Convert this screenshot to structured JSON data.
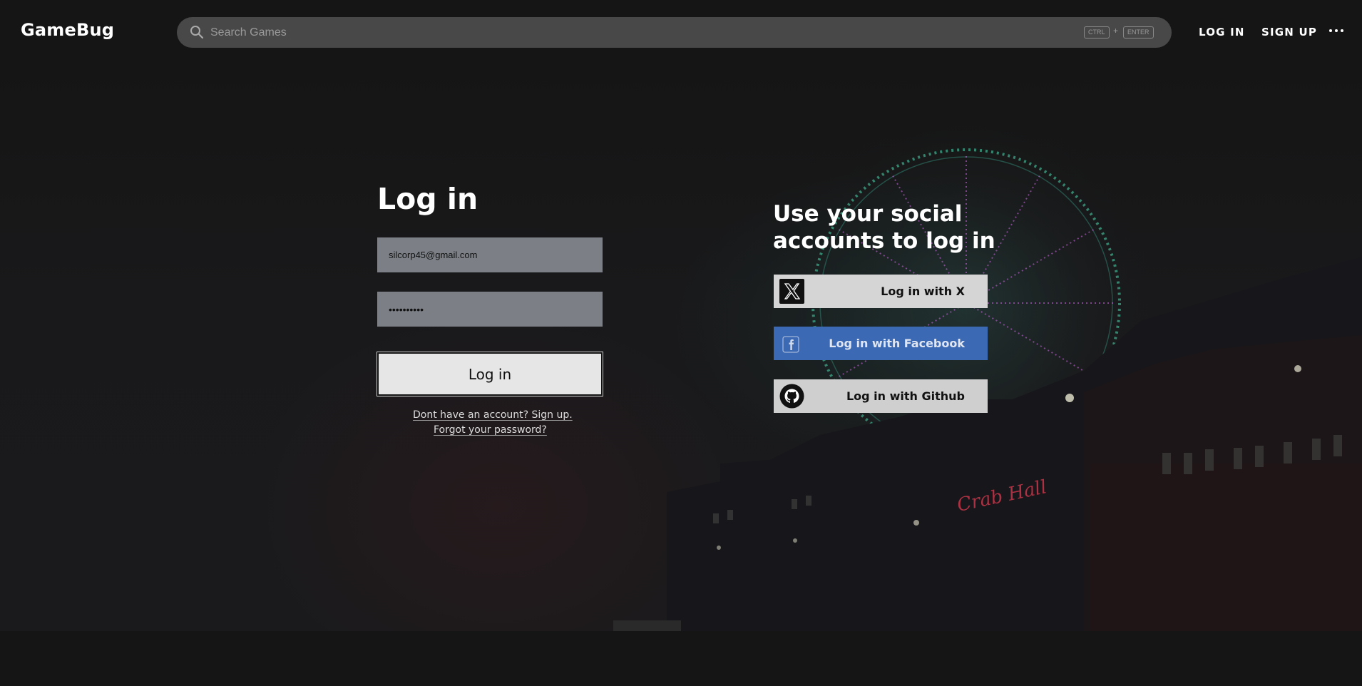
{
  "header": {
    "logo": "GameBug",
    "search": {
      "placeholder": "Search Games",
      "shortcut_key_1": "CTRL",
      "shortcut_plus": "+",
      "shortcut_key_2": "ENTER"
    },
    "nav": {
      "login_label": "LOG IN",
      "signup_label": "SIGN UP",
      "more_icon": "more-horizontal-icon"
    }
  },
  "login": {
    "title": "Log in",
    "email_value": "silcorp45@gmail.com",
    "password_value": "••••••••••",
    "submit_label": "Log in",
    "signup_link": "Dont have an account? Sign up.",
    "forgot_link": "Forgot your password?"
  },
  "social": {
    "title": "Use your social accounts to log in",
    "buttons": [
      {
        "label": "Log in with X",
        "icon": "x-logo-icon",
        "color": "#d5d5d5"
      },
      {
        "label": "Log in with Facebook",
        "icon": "facebook-logo-icon",
        "color": "#3c69b4"
      },
      {
        "label": "Log in with Github",
        "icon": "github-logo-icon",
        "color": "#cfcfcf"
      }
    ]
  },
  "background": {
    "neon_sign": "Crab Hall",
    "wheel_color": "#3fa88a",
    "spoke_color": "#b55cc9"
  }
}
